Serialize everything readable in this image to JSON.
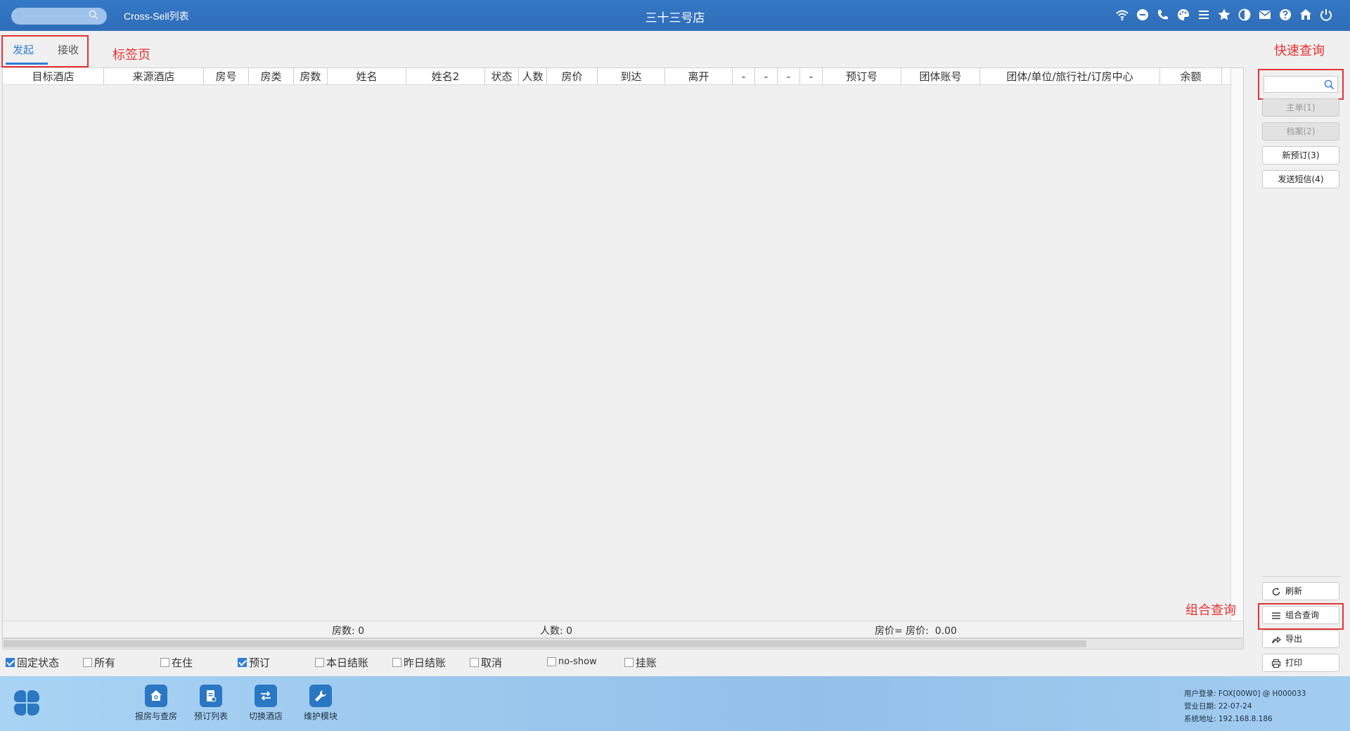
{
  "header": {
    "app_title": "Cross-Sell列表",
    "store_name": "三十三号店",
    "icons": [
      "wifi-icon",
      "chat-icon",
      "phone-icon",
      "palette-icon",
      "menu-icon",
      "star-icon",
      "theme-icon",
      "mail-icon",
      "help-icon",
      "home-icon",
      "power-icon"
    ]
  },
  "tabs": {
    "items": [
      "发起",
      "接收"
    ],
    "active": "发起",
    "annotation": "标签页"
  },
  "table": {
    "columns": [
      "目标酒店",
      "来源酒店",
      "房号",
      "房类",
      "房数",
      "姓名",
      "姓名2",
      "状态",
      "人数",
      "房价",
      "到达",
      "离开",
      "-",
      "-",
      "-",
      "-",
      "预订号",
      "团体账号",
      "团体/单位/旅行社/订房中心",
      "余额"
    ],
    "rows": [],
    "summary": {
      "room_count": "房数: 0",
      "person_count": "人数: 0",
      "price": "房价= 房价:  0.00"
    }
  },
  "filters": [
    {
      "label": "固定状态",
      "checked": true
    },
    {
      "label": "所有",
      "checked": false
    },
    {
      "label": "在住",
      "checked": false
    },
    {
      "label": "预订",
      "checked": true
    },
    {
      "label": "本日结账",
      "checked": false
    },
    {
      "label": "昨日结账",
      "checked": false
    },
    {
      "label": "取消",
      "checked": false
    },
    {
      "label": "no-show",
      "checked": false
    },
    {
      "label": "挂账",
      "checked": false
    }
  ],
  "right_panel": {
    "quick_search_annotation": "快速查询",
    "combo_query_annotation": "组合查询",
    "buttons": {
      "master": "主单(1)",
      "profile": "档案(2)",
      "new_booking": "新预订(3)",
      "send_sms": "发送短信(4)",
      "refresh": "刷新",
      "combo_query": "组合查询",
      "export": "导出",
      "print": "打印"
    }
  },
  "dock": {
    "items": [
      "报房与查房",
      "预订列表",
      "切换酒店",
      "维护模块"
    ]
  },
  "status": {
    "user": "用户登录:  FOX[00W0] @ H000033",
    "business_date": "营业日期:  22-07-24",
    "system_address": "系统地址:  192.168.8.186"
  },
  "colors": {
    "header": "#3478c6",
    "accent": "#2f7fd4",
    "annotation": "#e63232"
  }
}
